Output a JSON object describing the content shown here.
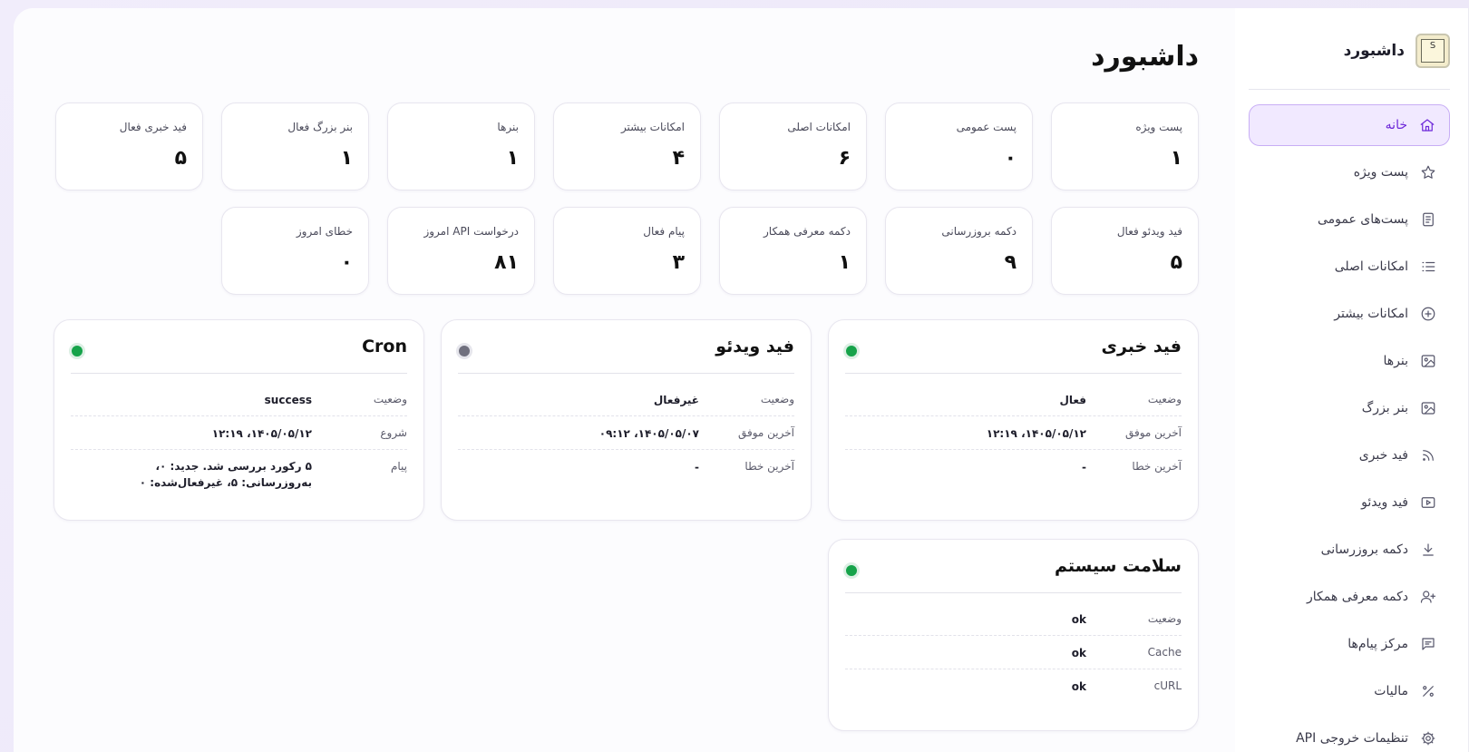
{
  "brand": {
    "name": "داشبورد",
    "logo_text": "S"
  },
  "nav": [
    {
      "label": "خانه",
      "icon": "home-icon",
      "active": true
    },
    {
      "label": "پست ویژه",
      "icon": "star-icon"
    },
    {
      "label": "پست‌های عمومی",
      "icon": "document-icon"
    },
    {
      "label": "امکانات اصلی",
      "icon": "list-icon"
    },
    {
      "label": "امکانات بیشتر",
      "icon": "plus-circle-icon"
    },
    {
      "label": "بنرها",
      "icon": "image-icon"
    },
    {
      "label": "بنر بزرگ",
      "icon": "image-icon"
    },
    {
      "label": "فید خبری",
      "icon": "rss-icon"
    },
    {
      "label": "فید ویدئو",
      "icon": "video-icon"
    },
    {
      "label": "دکمه بروزرسانی",
      "icon": "download-icon"
    },
    {
      "label": "دکمه معرفی همکار",
      "icon": "user-plus-icon"
    },
    {
      "label": "مرکز پیام‌ها",
      "icon": "message-icon"
    },
    {
      "label": "مالیات",
      "icon": "percent-icon"
    },
    {
      "label": "تنظیمات خروجی API",
      "icon": "gear-icon"
    }
  ],
  "page": {
    "title": "داشبورد"
  },
  "stats_row1": [
    {
      "label": "پست ویژه",
      "value": "۱"
    },
    {
      "label": "پست عمومی",
      "value": "۰"
    },
    {
      "label": "امکانات اصلی",
      "value": "۶"
    },
    {
      "label": "امکانات بیشتر",
      "value": "۴"
    },
    {
      "label": "بنرها",
      "value": "۱"
    },
    {
      "label": "بنر بزرگ فعال",
      "value": "۱"
    },
    {
      "label": "فید خبری فعال",
      "value": "۵"
    }
  ],
  "stats_row2": [
    {
      "label": "فید ویدئو فعال",
      "value": "۵"
    },
    {
      "label": "دکمه بروزرسانی",
      "value": "۹"
    },
    {
      "label": "دکمه معرفی همکار",
      "value": "۱"
    },
    {
      "label": "پیام فعال",
      "value": "۳"
    },
    {
      "label": "درخواست API امروز",
      "value": "۸۱"
    },
    {
      "label": "خطای امروز",
      "value": "۰"
    }
  ],
  "panels": {
    "news_feed": {
      "title": "فید خبری",
      "status_color": "#16a34a",
      "rows": [
        {
          "key": "وضعیت",
          "value": "فعال"
        },
        {
          "key": "آخرین موفق",
          "value": "۱۴۰۵/۰۵/۱۲، ۱۲:۱۹"
        },
        {
          "key": "آخرین خطا",
          "value": "-"
        }
      ]
    },
    "video_feed": {
      "title": "فید ویدئو",
      "status_color": "#70707e",
      "rows": [
        {
          "key": "وضعیت",
          "value": "غیرفعال"
        },
        {
          "key": "آخرین موفق",
          "value": "۱۴۰۵/۰۵/۰۷، ۰۹:۱۲"
        },
        {
          "key": "آخرین خطا",
          "value": "-"
        }
      ]
    },
    "cron": {
      "title": "Cron",
      "status_color": "#16a34a",
      "rows": [
        {
          "key": "وضعیت",
          "value": "success"
        },
        {
          "key": "شروع",
          "value": "۱۴۰۵/۰۵/۱۲، ۱۲:۱۹"
        },
        {
          "key": "پیام",
          "value": "۵ رکورد بررسی شد. جدید: ۰، به‌روزرسانی: ۵، غیرفعال‌شده: ۰"
        }
      ]
    },
    "system_health": {
      "title": "سلامت سیستم",
      "status_color": "#16a34a",
      "rows": [
        {
          "key": "وضعیت",
          "value": "ok"
        },
        {
          "key": "Cache",
          "value": "ok"
        },
        {
          "key": "cURL",
          "value": "ok"
        }
      ]
    }
  }
}
